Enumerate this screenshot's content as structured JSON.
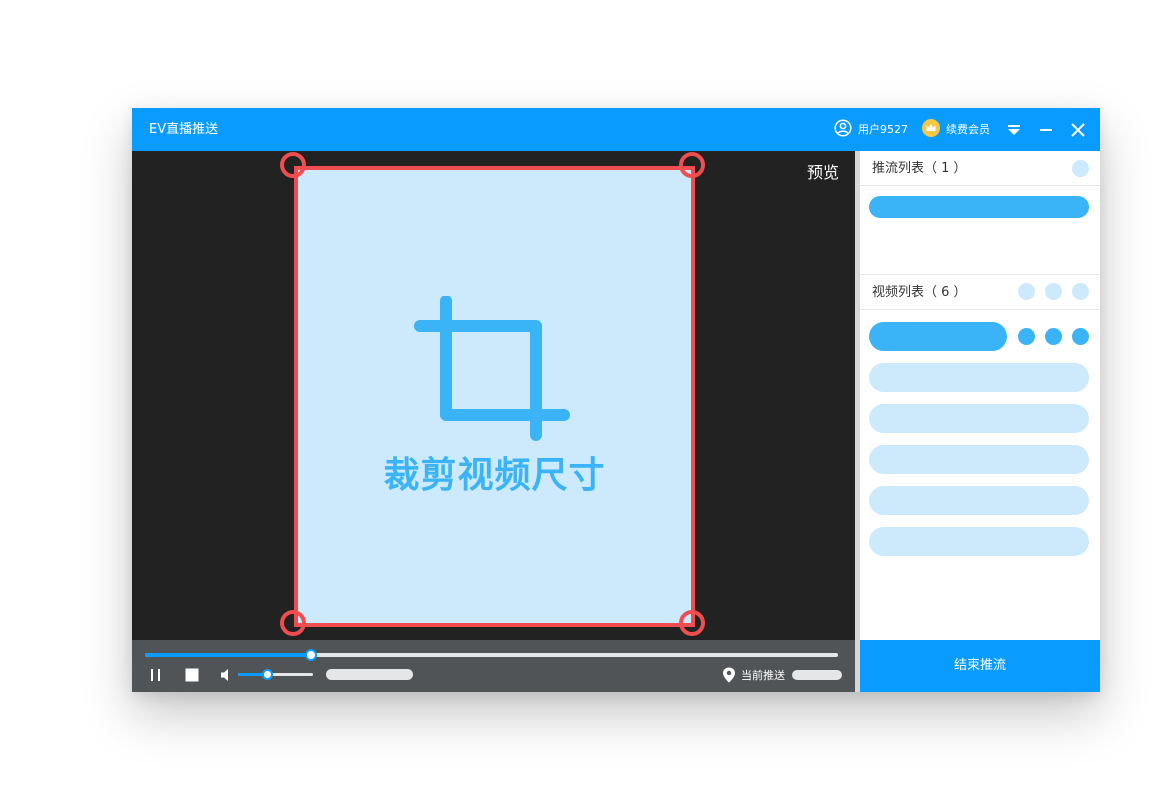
{
  "app": {
    "title": "EV直播推送",
    "user_label": "用户9527",
    "member_label": "续费会员"
  },
  "icons": {
    "user": "user-circle-icon",
    "member": "crown-icon",
    "menu": "dropdown-menu-icon",
    "minimize": "minimize-icon",
    "close": "close-icon",
    "crop": "crop-icon",
    "pause": "pause-icon",
    "stop": "stop-icon",
    "volume": "volume-icon",
    "location": "location-pin-icon"
  },
  "stage": {
    "preview_label": "预览",
    "crop_label": "裁剪视频尺寸"
  },
  "controls": {
    "progress": 0.24,
    "volume": 0.39,
    "push_label": "当前推送"
  },
  "sidebar": {
    "push_list_title": "推流列表（ 1 ）",
    "video_list_title": "视频列表（ 6 ）",
    "end_button_label": "结束推流"
  },
  "colors": {
    "titlebar": "#0a9bff",
    "accent_light": "#cceafb",
    "accent": "#3bb4f7",
    "crop_border": "#ef4d4f",
    "stage_bg": "#222222",
    "controls_bg": "#505457"
  }
}
